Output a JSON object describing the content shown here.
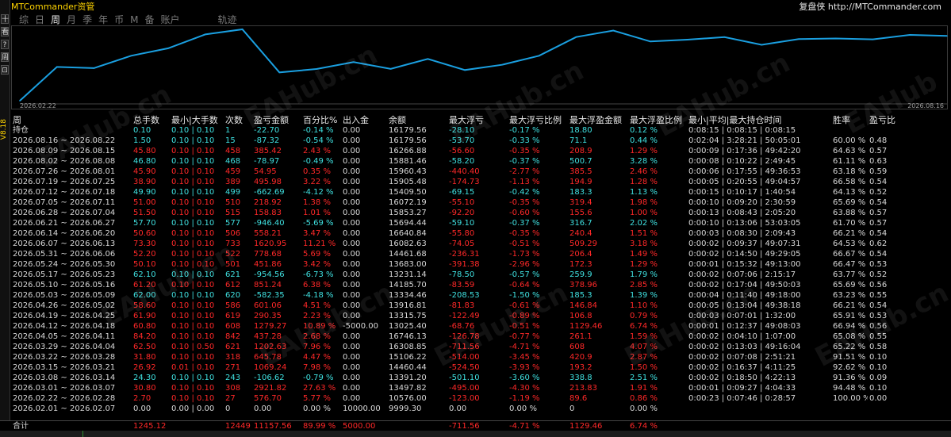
{
  "app": {
    "title": "MTCommander资管",
    "brand": "复盘侠 http://MTCommander.com",
    "version": "V8.18"
  },
  "sidebar": {
    "icons": [
      "十",
      "看",
      "?",
      "周",
      "⊡"
    ]
  },
  "tabs": [
    {
      "label": "综"
    },
    {
      "label": "日"
    },
    {
      "label": "周"
    },
    {
      "label": "月"
    },
    {
      "label": "季"
    },
    {
      "label": "年"
    },
    {
      "label": "币"
    },
    {
      "label": "M"
    },
    {
      "label": "备"
    },
    {
      "label": "账户"
    },
    {
      "label": "轨迹"
    }
  ],
  "active_tab": 2,
  "chart": {
    "start_label": "2026.02.22",
    "end_label": "2026.08.16",
    "line_color": "#1a9fe0"
  },
  "chart_data": {
    "type": "line",
    "x": [
      "2026.02.22",
      "2026.03.01",
      "2026.03.08",
      "2026.03.15",
      "2026.03.22",
      "2026.03.29",
      "2026.04.05",
      "2026.04.12",
      "2026.04.19",
      "2026.04.26",
      "2026.05.03",
      "2026.05.10",
      "2026.05.17",
      "2026.05.24",
      "2026.05.31",
      "2026.06.07",
      "2026.06.14",
      "2026.06.21",
      "2026.06.28",
      "2026.07.05",
      "2026.07.12",
      "2026.07.19",
      "2026.07.26",
      "2026.08.02",
      "2026.08.09",
      "2026.08.16"
    ],
    "values": [
      10576.0,
      13497.82,
      13391.2,
      14460.44,
      15106.22,
      16308.85,
      16746.13,
      13025.4,
      13315.75,
      13916.81,
      13334.46,
      14185.7,
      13231.14,
      13683.0,
      14461.68,
      16082.63,
      16640.84,
      15694.44,
      15853.27,
      16072.19,
      15409.5,
      15905.48,
      15960.43,
      15881.46,
      16266.88,
      16179.56
    ],
    "xlabel": "",
    "ylabel": ""
  },
  "table": {
    "headers": [
      "周",
      "总手数",
      "最小|大手数",
      "次数",
      "盈亏金额",
      "百分比%",
      "出入金",
      "余额",
      "最大浮亏",
      "最大浮亏比例",
      "最大浮盈金额",
      "最大浮盈比例",
      "最小|平均|最大持仓时间",
      "",
      "胜率",
      "盈亏比"
    ],
    "rows": [
      {
        "k": "pos",
        "c": [
          "持仓",
          "0.10",
          "0.10 | 0.10",
          "1",
          "-22.70",
          "-0.14 %",
          "0.00",
          "16179.56",
          "-28.10",
          "-0.17 %",
          "18.80",
          "0.12 %",
          "0:08:15 | 0:08:15 | 0:08:15",
          "",
          "",
          ""
        ]
      },
      {
        "k": "pos",
        "c": [
          "2026.08.16 ~ 2026.08.22",
          "1.50",
          "0.10 | 0.10",
          "15",
          "-87.32",
          "-0.54 %",
          "0.00",
          "16179.56",
          "-53.70",
          "-0.33 %",
          "71.1",
          "0.44 %",
          "0:02:04 | 3:28:21 | 50:05:01",
          "",
          "60.00 %",
          "0.48"
        ]
      },
      {
        "k": "neg",
        "c": [
          "2026.08.09 ~ 2026.08.15",
          "45.80",
          "0.10 | 0.10",
          "458",
          "385.42",
          "2.43 %",
          "0.00",
          "16266.88",
          "-56.60",
          "-0.35 %",
          "208.9",
          "1.29 %",
          "0:00:09 | 0:17:36 | 49:42:20",
          "",
          "64.63 %",
          "0.57"
        ]
      },
      {
        "k": "pos",
        "c": [
          "2026.08.02 ~ 2026.08.08",
          "46.80",
          "0.10 | 0.10",
          "468",
          "-78.97",
          "-0.49 %",
          "0.00",
          "15881.46",
          "-58.20",
          "-0.37 %",
          "500.7",
          "3.28 %",
          "0:00:08 | 0:10:22 | 2:49:45",
          "",
          "61.11 %",
          "0.63"
        ]
      },
      {
        "k": "neg",
        "c": [
          "2026.07.26 ~ 2026.08.01",
          "45.90",
          "0.10 | 0.10",
          "459",
          "54.95",
          "0.35 %",
          "0.00",
          "15960.43",
          "-440.40",
          "-2.77 %",
          "385.5",
          "2.46 %",
          "0:00:06 | 0:17:55 | 49:36:53",
          "",
          "63.18 %",
          "0.59"
        ]
      },
      {
        "k": "neg",
        "c": [
          "2026.07.19 ~ 2026.07.25",
          "38.90",
          "0.10 | 0.10",
          "389",
          "495.98",
          "3.22 %",
          "0.00",
          "15905.48",
          "-174.73",
          "-1.13 %",
          "194.9",
          "1.28 %",
          "0:00:05 | 0:20:55 | 49:04:57",
          "",
          "66.58 %",
          "0.54"
        ]
      },
      {
        "k": "pos",
        "c": [
          "2026.07.12 ~ 2026.07.18",
          "49.90",
          "0.10 | 0.10",
          "499",
          "-662.69",
          "-4.12 %",
          "0.00",
          "15409.50",
          "-69.15",
          "-0.42 %",
          "183.3",
          "1.13 %",
          "0:00:15 | 0:10:17 | 1:40:54",
          "",
          "64.13 %",
          "0.52"
        ]
      },
      {
        "k": "neg",
        "c": [
          "2026.07.05 ~ 2026.07.11",
          "51.00",
          "0.10 | 0.10",
          "510",
          "218.92",
          "1.38 %",
          "0.00",
          "16072.19",
          "-55.10",
          "-0.35 %",
          "319.4",
          "1.98 %",
          "0:00:10 | 0:09:20 | 2:30:59",
          "",
          "65.69 %",
          "0.54"
        ]
      },
      {
        "k": "neg",
        "c": [
          "2026.06.28 ~ 2026.07.04",
          "51.50",
          "0.10 | 0.10",
          "515",
          "158.83",
          "1.01 %",
          "0.00",
          "15853.27",
          "-92.20",
          "-0.60 %",
          "155.6",
          "1.00 %",
          "0:00:13 | 0:08:43 | 2:05:20",
          "",
          "63.88 %",
          "0.57"
        ]
      },
      {
        "k": "pos",
        "c": [
          "2026.06.21 ~ 2026.06.27",
          "57.70",
          "0.10 | 0.10",
          "577",
          "-946.40",
          "-5.69 %",
          "0.00",
          "15694.44",
          "-59.10",
          "-0.37 %",
          "316.7",
          "2.02 %",
          "0:00:10 | 0:13:06 | 53:03:05",
          "",
          "61.70 %",
          "0.57"
        ]
      },
      {
        "k": "neg",
        "c": [
          "2026.06.14 ~ 2026.06.20",
          "50.60",
          "0.10 | 0.10",
          "506",
          "558.21",
          "3.47 %",
          "0.00",
          "16640.84",
          "-55.80",
          "-0.35 %",
          "240.4",
          "1.51 %",
          "0:00:03 | 0:08:30 | 2:09:43",
          "",
          "66.21 %",
          "0.54"
        ]
      },
      {
        "k": "neg",
        "c": [
          "2026.06.07 ~ 2026.06.13",
          "73.30",
          "0.10 | 0.10",
          "733",
          "1620.95",
          "11.21 %",
          "0.00",
          "16082.63",
          "-74.05",
          "-0.51 %",
          "509.29",
          "3.18 %",
          "0:00:02 | 0:09:37 | 49:07:31",
          "",
          "64.53 %",
          "0.62"
        ]
      },
      {
        "k": "neg",
        "c": [
          "2026.05.31 ~ 2026.06.06",
          "52.20",
          "0.10 | 0.10",
          "522",
          "778.68",
          "5.69 %",
          "0.00",
          "14461.68",
          "-236.31",
          "-1.73 %",
          "206.4",
          "1.49 %",
          "0:00:02 | 0:14:50 | 49:29:05",
          "",
          "66.67 %",
          "0.54"
        ]
      },
      {
        "k": "neg",
        "c": [
          "2026.05.24 ~ 2026.05.30",
          "50.10",
          "0.10 | 0.10",
          "501",
          "451.86",
          "3.42 %",
          "0.00",
          "13683.00",
          "-391.38",
          "-2.96 %",
          "172.3",
          "1.29 %",
          "0:00:01 | 0:15:32 | 49:13:00",
          "",
          "66.47 %",
          "0.53"
        ]
      },
      {
        "k": "pos",
        "c": [
          "2026.05.17 ~ 2026.05.23",
          "62.10",
          "0.10 | 0.10",
          "621",
          "-954.56",
          "-6.73 %",
          "0.00",
          "13231.14",
          "-78.50",
          "-0.57 %",
          "259.9",
          "1.79 %",
          "0:00:02 | 0:07:06 | 2:15:17",
          "",
          "63.77 %",
          "0.52"
        ]
      },
      {
        "k": "neg",
        "c": [
          "2026.05.10 ~ 2026.05.16",
          "61.20",
          "0.10 | 0.10",
          "612",
          "851.24",
          "6.38 %",
          "0.00",
          "14185.70",
          "-83.59",
          "-0.64 %",
          "378.96",
          "2.85 %",
          "0:00:02 | 0:17:04 | 49:50:03",
          "",
          "65.69 %",
          "0.56"
        ]
      },
      {
        "k": "pos",
        "c": [
          "2026.05.03 ~ 2026.05.09",
          "62.00",
          "0.10 | 0.10",
          "620",
          "-582.35",
          "-4.18 %",
          "0.00",
          "13334.46",
          "-208.53",
          "-1.50 %",
          "185.3",
          "1.39 %",
          "0:00:04 | 0:11:40 | 49:18:00",
          "",
          "63.23 %",
          "0.55"
        ]
      },
      {
        "k": "neg",
        "c": [
          "2026.04.26 ~ 2026.05.02",
          "58.60",
          "0.10 | 0.10",
          "586",
          "601.06",
          "4.51 %",
          "0.00",
          "13916.81",
          "-81.83",
          "-0.61 %",
          "146.84",
          "1.10 %",
          "0:00:05 | 0:13:04 | 49:38:18",
          "",
          "66.21 %",
          "0.54"
        ]
      },
      {
        "k": "neg",
        "c": [
          "2026.04.19 ~ 2026.04.25",
          "61.90",
          "0.10 | 0.10",
          "619",
          "290.35",
          "2.23 %",
          "0.00",
          "13315.75",
          "-122.49",
          "-0.89 %",
          "106.8",
          "0.79 %",
          "0:00:03 | 0:07:01 | 1:32:00",
          "",
          "65.91 %",
          "0.53"
        ]
      },
      {
        "k": "neg",
        "c": [
          "2026.04.12 ~ 2026.04.18",
          "60.80",
          "0.10 | 0.10",
          "608",
          "1279.27",
          "10.89 %",
          "-5000.00",
          "13025.40",
          "-68.76",
          "-0.51 %",
          "1129.46",
          "6.74 %",
          "0:00:01 | 0:12:37 | 49:08:03",
          "",
          "66.94 %",
          "0.56"
        ]
      },
      {
        "k": "neg",
        "c": [
          "2026.04.05 ~ 2026.04.11",
          "84.20",
          "0.10 | 0.10",
          "842",
          "437.28",
          "2.68 %",
          "0.00",
          "16746.13",
          "-126.78",
          "-0.77 %",
          "261.1",
          "1.59 %",
          "0:00:02 | 0:04:10 | 1:07:00",
          "",
          "65.08 %",
          "0.55"
        ]
      },
      {
        "k": "neg",
        "c": [
          "2026.03.29 ~ 2026.04.04",
          "62.50",
          "0.10 | 0.50",
          "621",
          "1202.63",
          "7.96 %",
          "0.00",
          "16308.85",
          "-711.56",
          "-4.71 %",
          "608",
          "4.07 %",
          "0:00:02 | 0:13:03 | 49:16:04",
          "",
          "65.22 %",
          "0.58"
        ]
      },
      {
        "k": "neg",
        "c": [
          "2026.03.22 ~ 2026.03.28",
          "31.80",
          "0.10 | 0.10",
          "318",
          "645.78",
          "4.47 %",
          "0.00",
          "15106.22",
          "-514.00",
          "-3.45 %",
          "420.9",
          "2.87 %",
          "0:00:02 | 0:07:08 | 2:51:21",
          "",
          "91.51 %",
          "0.10"
        ]
      },
      {
        "k": "neg",
        "c": [
          "2026.03.15 ~ 2026.03.21",
          "26.92",
          "0.01 | 0.10",
          "271",
          "1069.24",
          "7.98 %",
          "0.00",
          "14460.44",
          "-524.50",
          "-3.93 %",
          "193.2",
          "1.50 %",
          "0:00:02 | 0:16:37 | 4:11:25",
          "",
          "92.62 %",
          "0.10"
        ]
      },
      {
        "k": "pos",
        "c": [
          "2026.03.08 ~ 2026.03.14",
          "24.30",
          "0.10 | 0.10",
          "243",
          "-106.62",
          "-0.79 %",
          "0.00",
          "13391.20",
          "-501.10",
          "-3.60 %",
          "338.8",
          "2.51 %",
          "0:00:02 | 0:18:50 | 4:22:13",
          "",
          "91.36 %",
          "0.09"
        ]
      },
      {
        "k": "neg",
        "c": [
          "2026.03.01 ~ 2026.03.07",
          "30.80",
          "0.10 | 0.10",
          "308",
          "2921.82",
          "27.63 %",
          "0.00",
          "13497.82",
          "-495.00",
          "-4.30 %",
          "213.83",
          "1.91 %",
          "0:00:01 | 0:09:27 | 4:04:33",
          "",
          "94.48 %",
          "0.10"
        ]
      },
      {
        "k": "neg",
        "c": [
          "2026.02.22 ~ 2026.02.28",
          "2.70",
          "0.10 | 0.10",
          "27",
          "576.70",
          "5.77 %",
          "0.00",
          "10576.00",
          "-123.00",
          "-1.19 %",
          "89.6",
          "0.86 %",
          "0:00:23 | 0:07:46 | 0:28:57",
          "",
          "100.00 %",
          "0.00"
        ]
      },
      {
        "k": "zero",
        "c": [
          "2026.02.01 ~ 2026.02.07",
          "0.00",
          "0.00 | 0.00",
          "0",
          "0.00",
          "0.00 %",
          "10000.00",
          "9999.30",
          "0.00",
          "0.00 %",
          "0",
          "0.00 %",
          "",
          "",
          "",
          ""
        ]
      }
    ],
    "total": [
      "合计",
      "1245.12",
      "",
      "12449",
      "11157.56",
      "89.99 %",
      "5000.00",
      "",
      "-711.56",
      "-4.71 %",
      "1129.46",
      "6.74 %",
      "",
      "",
      "",
      ""
    ]
  }
}
